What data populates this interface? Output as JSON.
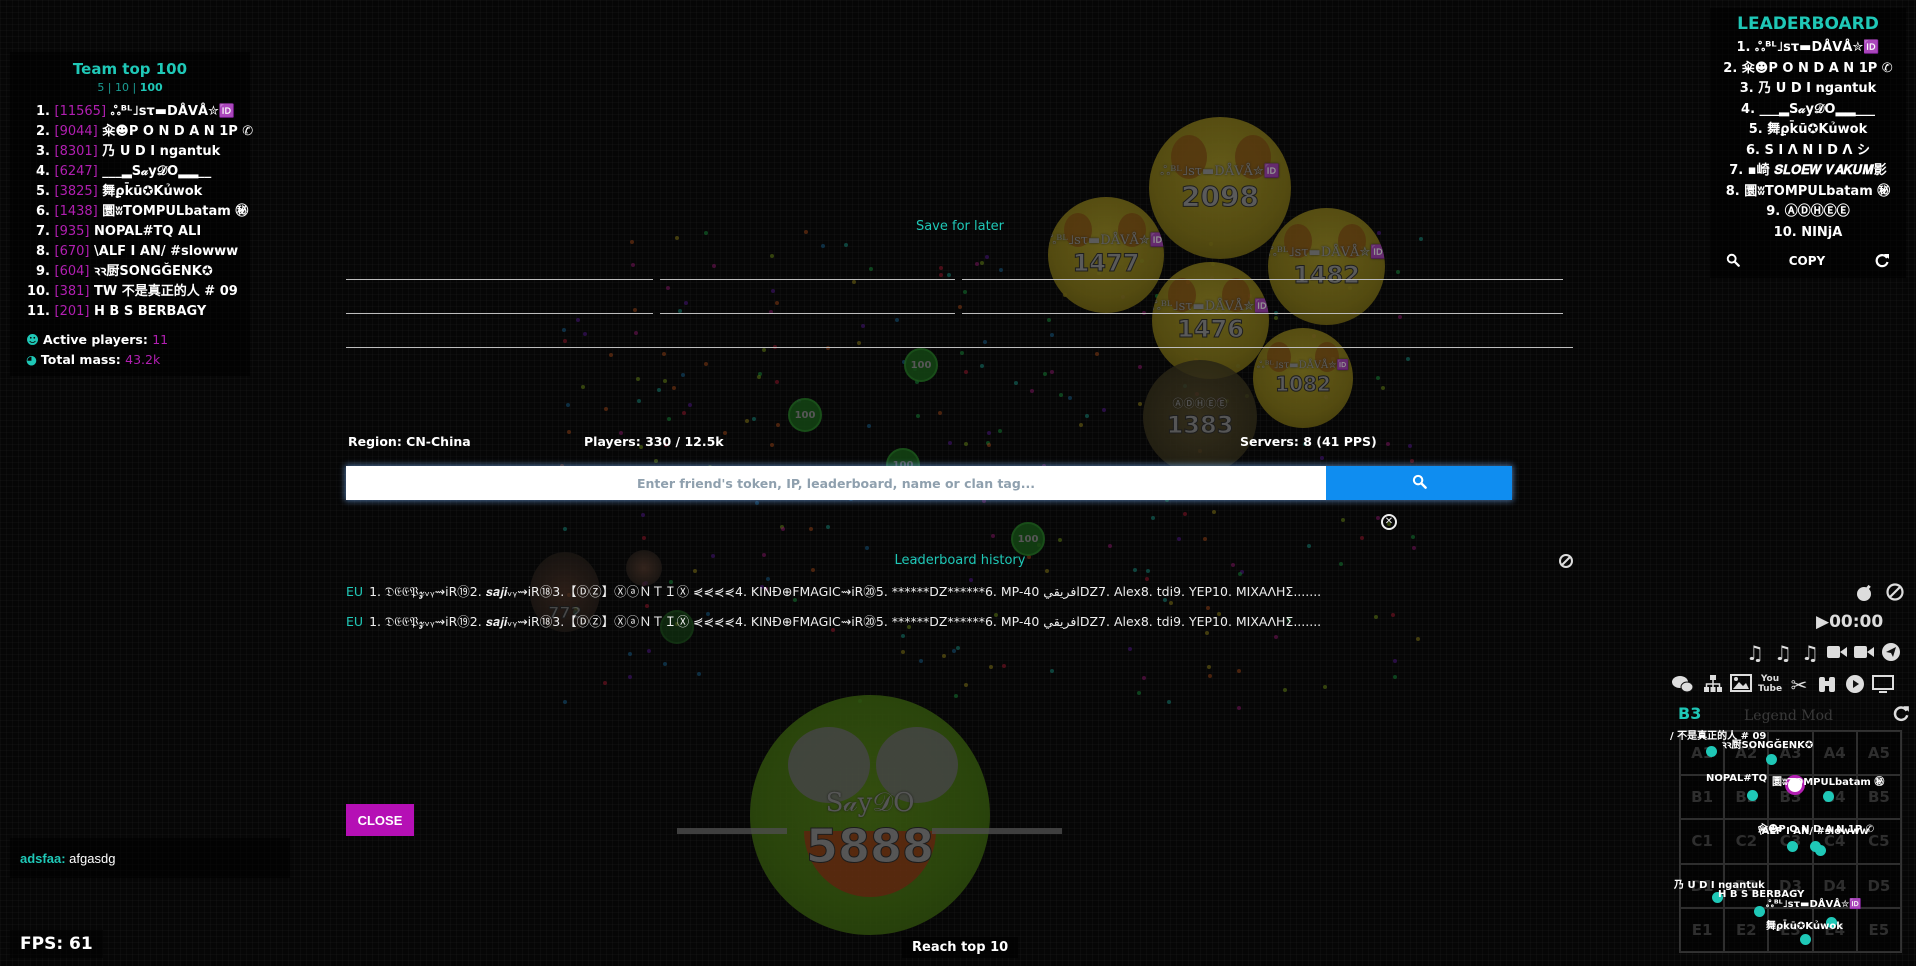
{
  "colors": {
    "accent": "#1fc8b7",
    "mass_purple": "#b21fb2",
    "close_button": "#b50fb5",
    "search_button": "#0f8df0"
  },
  "team_panel": {
    "title": "Team top 100",
    "filters": [
      "5",
      "10",
      "100"
    ],
    "members": [
      {
        "rank": "1.",
        "mass": "[11565]",
        "name": "ஃᴮᴸ˩ѕτ▬DÅVÅ✮🆔"
      },
      {
        "rank": "2.",
        "mass": "[9044]",
        "name": "籴☻P O N D A N 1P ✆"
      },
      {
        "rank": "3.",
        "mass": "[8301]",
        "name": "乃 U D I ngantuk"
      },
      {
        "rank": "4.",
        "mass": "[6247]",
        "name": "___▂S𝒶y𝒟O▂▂__"
      },
      {
        "rank": "5.",
        "mass": "[3825]",
        "name": "舞ϼk̄ū✪Kủwok"
      },
      {
        "rank": "6.",
        "mass": "[1438]",
        "name": "圜ʬTOMPULbatam ㊙"
      },
      {
        "rank": "7.",
        "mass": "[935]",
        "name": "NOPAL#TQ ALI"
      },
      {
        "rank": "8.",
        "mass": "[670]",
        "name": "\\ALF I AN/ #slowww"
      },
      {
        "rank": "9.",
        "mass": "[604]",
        "name": "ꝛꝛ厨SONGĞENK✪"
      },
      {
        "rank": "10.",
        "mass": "[381]",
        "name": "TW 不是真正的人 # 09"
      },
      {
        "rank": "11.",
        "mass": "[201]",
        "name": "H B S BERBAGY"
      }
    ],
    "active_players_label": "Active players:",
    "active_players_value": "11",
    "total_mass_label": "Total mass:",
    "total_mass_value": "43.2k"
  },
  "leaderboard": {
    "title": "LEADERBOARD",
    "entries": [
      "1. ஃᴮᴸ˩ѕτ▬DÅVÅ✮🆔",
      "2. 籴☻P O N D A N 1P ✆",
      "3. 乃 U D I ngantuk",
      "4. ___▂S𝒶y𝒟O▂▂___",
      "5. 舞ϼk̄ū✪Kủwok",
      "6. S I Λ N I D Λ シ",
      "7. ▪崎 𝑺𝑳𝑶𝑬𝑾 𝑽𝑨𝑲𝑼𝑴影",
      "8. 圜ʬTOMPULbatam ㊙",
      "9. ⒶⒹⒽⒺⒺ",
      "10. NINjA"
    ],
    "search_icon": "search-icon",
    "copy_label": "COPY",
    "refresh_icon": "refresh-icon"
  },
  "modal": {
    "save_for_later": "Save for later",
    "region": "Region: CN-China",
    "players": "Players: 330 / 12.5k",
    "servers": "Servers: 8 (41 PPS)",
    "search_placeholder": "Enter friend's token, IP, leaderboard, name or clan tag...",
    "search_value": "",
    "leaderboard_history_title": "Leaderboard history",
    "history": [
      {
        "region": "EU",
        "text": "1. 𝔇𝔈𝔈𝔓𝔃ᵥᵧ⇝iR⑲2. 𝒔𝒂𝒋𝒊ᵥᵧ⇝iR⑱3.【ⒹⓏ】ⓍⓐＮＴＩⓍ ⋞⋞⋞⋞4. KINĐ⊕FMAGIC⇝iR⑳5. ******DZ******6. MP-40 افريقيDZ7. Alex8. tdi9. YEP10. ΜΙΧΑΛΗΣ......."
      },
      {
        "region": "EU",
        "text": "1. 𝔇𝔈𝔈𝔓𝔃ᵥᵧ⇝iR⑲2. 𝒔𝒂𝒋𝒊ᵥᵧ⇝iR⑱3.【ⒹⓏ】ⓍⓐＮＴＩⓍ ⋞⋞⋞⋞4. KINĐ⊕FMAGIC⇝iR⑳5. ******DZ******6. MP-40 افريقيDZ7. Alex8. tdi9. YEP10. ΜΙΧΑΛΗΣ......."
      }
    ],
    "close_label": "CLOSE"
  },
  "game": {
    "virus_mass": "100",
    "cells": [
      {
        "name": "ஃᴮᴸ˩ѕτ▬DÅVÅ✮🆔",
        "mass": "2098"
      },
      {
        "name": "ஃᴮᴸ˩ѕτ▬DÅVÅ✮🆔",
        "mass": "1477"
      },
      {
        "name": "ஃᴮᴸ˩ѕτ▬DÅVÅ✮🆔",
        "mass": "1482"
      },
      {
        "name": "ஃᴮᴸ˩ѕτ▬DÅVÅ✮🆔",
        "mass": "1476"
      },
      {
        "name": "ஃᴮᴸ˩ѕτ▬DÅVÅ✮🆔",
        "mass": "1082"
      },
      {
        "name": "ⒶⒹⒽⒺⒺ",
        "mass": "1383"
      },
      {
        "name": "S𝒶y𝒟O",
        "mass": "5888"
      },
      {
        "name": "",
        "mass": "772"
      }
    ]
  },
  "chat": {
    "sender": "adsfaa:",
    "message": "afgasdg"
  },
  "fps": "FPS: 61",
  "reach_top": "Reach top 10",
  "tools": {
    "timer": "00:00",
    "icons_row1": [
      "bomb-icon",
      "ban-icon"
    ],
    "icons_row2": [
      "music-icon",
      "music-icon",
      "music-icon",
      "video-icon",
      "video-icon",
      "telegram-icon"
    ],
    "icons_row3": [
      "chat-icon",
      "sitemap-icon",
      "image-icon",
      "youtube-icon",
      "scissors-icon",
      "binoculars-icon",
      "play-circle-icon",
      "monitor-icon"
    ]
  },
  "minimap": {
    "current_sector": "B3",
    "title": "Legend Mod",
    "sectors": [
      "A1",
      "A2",
      "A3",
      "A4",
      "A5",
      "B1",
      "B2",
      "B3",
      "B4",
      "B5",
      "C1",
      "C2",
      "C3",
      "C4",
      "C5",
      "D1",
      "D2",
      "D3",
      "D4",
      "D5",
      "E1",
      "E2",
      "E3",
      "E4",
      "E5"
    ],
    "labels": [
      "/ 不是真正的人 # 09",
      "ꝛꝛ厨SONGĞENK✪",
      "NOPAL#TQ",
      "圜ʬTOMPULbatam ㊙",
      "籴☻P O N D A N 1P ✆",
      "\\ALF I AN/ #slowww",
      "乃 U D I ngantuk",
      "H B S BERBAGY",
      "ஃᴮᴸ˩ѕτ▬DÅVÅ✮🆔",
      "舞ϼk̄ū✪Kủwok"
    ]
  }
}
